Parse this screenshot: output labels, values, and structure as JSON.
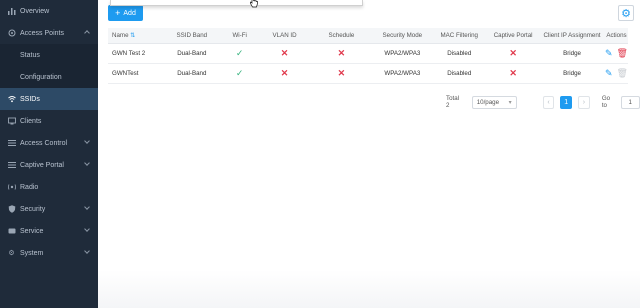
{
  "sidebar": {
    "items": [
      {
        "label": "Overview",
        "icon": "bar-chart-icon"
      },
      {
        "label": "Access Points",
        "icon": "access-point-icon"
      },
      {
        "label": "Status"
      },
      {
        "label": "Configuration"
      },
      {
        "label": "SSIDs",
        "icon": "wifi-icon"
      },
      {
        "label": "Clients",
        "icon": "clients-icon"
      },
      {
        "label": "Access Control",
        "icon": "list-icon"
      },
      {
        "label": "Captive Portal",
        "icon": "list-icon"
      },
      {
        "label": "Radio",
        "icon": "radio-icon"
      },
      {
        "label": "Security",
        "icon": "shield-icon"
      },
      {
        "label": "Service",
        "icon": "service-icon"
      },
      {
        "label": "System",
        "icon": "gear-icon"
      }
    ]
  },
  "toolbar": {
    "add_label": "Add"
  },
  "table": {
    "columns": [
      "Name",
      "SSID Band",
      "Wi-Fi",
      "VLAN ID",
      "Schedule",
      "Security Mode",
      "MAC Filtering",
      "Captive Portal",
      "Client IP Assignment",
      "Actions"
    ],
    "rows": [
      {
        "name": "GWN Test 2",
        "band": "Dual-Band",
        "security": "WPA2/WPA3",
        "mac": "Disabled",
        "ip": "Bridge"
      },
      {
        "name": "GWNTest",
        "band": "Dual-Band",
        "security": "WPA2/WPA3",
        "mac": "Disabled",
        "ip": "Bridge"
      }
    ]
  },
  "pagination": {
    "total_label": "Total 2",
    "per_page": "10/page",
    "current_page": "1",
    "goto_label": "Go to",
    "goto_value": "1"
  },
  "colors": {
    "accent": "#1e9bf0",
    "sidebar_bg": "#1f2b3a",
    "active_bg": "#2d4a66",
    "check": "#36b37e",
    "cross": "#e0394c"
  }
}
